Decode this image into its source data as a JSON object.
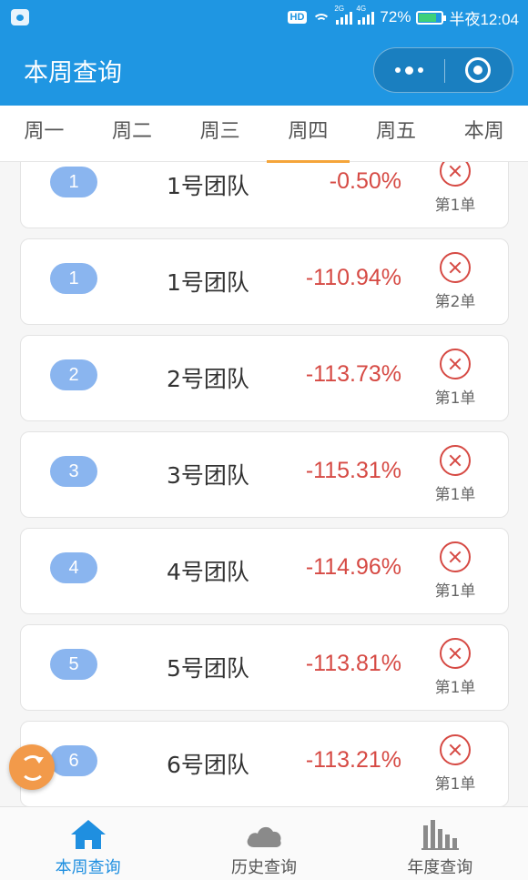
{
  "status_bar": {
    "hd_badge": "HD",
    "net_1": "2G",
    "net_2": "4G",
    "battery": "72%",
    "time": "半夜12:04"
  },
  "header": {
    "title": "本周查询"
  },
  "tabs": [
    {
      "label": "周一"
    },
    {
      "label": "周二"
    },
    {
      "label": "周三"
    },
    {
      "label": "周四"
    },
    {
      "label": "周五"
    },
    {
      "label": "本周"
    }
  ],
  "active_tab": "周四",
  "rows": [
    {
      "rank": "1",
      "team": "1号团队",
      "pct": "-0.50%",
      "order": "第1单"
    },
    {
      "rank": "1",
      "team": "1号团队",
      "pct": "-110.94%",
      "order": "第2单"
    },
    {
      "rank": "2",
      "team": "2号团队",
      "pct": "-113.73%",
      "order": "第1单"
    },
    {
      "rank": "3",
      "team": "3号团队",
      "pct": "-115.31%",
      "order": "第1单"
    },
    {
      "rank": "4",
      "team": "4号团队",
      "pct": "-114.96%",
      "order": "第1单"
    },
    {
      "rank": "5",
      "team": "5号团队",
      "pct": "-113.81%",
      "order": "第1单"
    },
    {
      "rank": "6",
      "team": "6号团队",
      "pct": "-113.21%",
      "order": "第1单"
    }
  ],
  "bottom_nav": [
    {
      "label": "本周查询",
      "icon": "home-icon"
    },
    {
      "label": "历史查询",
      "icon": "cloud-icon"
    },
    {
      "label": "年度查询",
      "icon": "bar-chart-icon"
    }
  ],
  "colors": {
    "primary": "#1f96e2",
    "negative": "#d64a44",
    "accent": "#f5a53a",
    "rank_pill": "#8ab5ef"
  }
}
